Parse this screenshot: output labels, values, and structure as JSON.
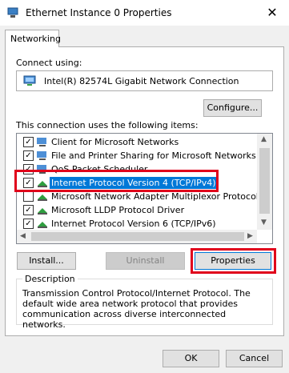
{
  "window": {
    "title": "Ethernet Instance 0 Properties",
    "close_glyph": "✕"
  },
  "tabs": [
    {
      "label": "Networking"
    }
  ],
  "connect_using": {
    "label": "Connect using:",
    "adapter": "Intel(R) 82574L Gigabit Network Connection",
    "configure_label": "Configure..."
  },
  "items_section": {
    "label": "This connection uses the following items:",
    "items": [
      {
        "label": "Client for Microsoft Networks",
        "checked": true,
        "icon": "network-client-icon"
      },
      {
        "label": "File and Printer Sharing for Microsoft Networks",
        "checked": true,
        "icon": "network-service-icon"
      },
      {
        "label": "QoS Packet Scheduler",
        "checked": true,
        "icon": "network-service-icon"
      },
      {
        "label": "Internet Protocol Version 4 (TCP/IPv4)",
        "checked": true,
        "icon": "protocol-icon",
        "selected": true
      },
      {
        "label": "Microsoft Network Adapter Multiplexor Protocol",
        "checked": false,
        "icon": "protocol-icon"
      },
      {
        "label": "Microsoft LLDP Protocol Driver",
        "checked": true,
        "icon": "protocol-icon"
      },
      {
        "label": "Internet Protocol Version 6 (TCP/IPv6)",
        "checked": true,
        "icon": "protocol-icon"
      }
    ]
  },
  "buttons": {
    "install": "Install...",
    "uninstall": "Uninstall",
    "properties": "Properties",
    "ok": "OK",
    "cancel": "Cancel"
  },
  "description": {
    "legend": "Description",
    "text": "Transmission Control Protocol/Internet Protocol. The default wide area network protocol that provides communication across diverse interconnected networks."
  },
  "colors": {
    "highlight": "#e0001b",
    "selection": "#0078d7"
  }
}
